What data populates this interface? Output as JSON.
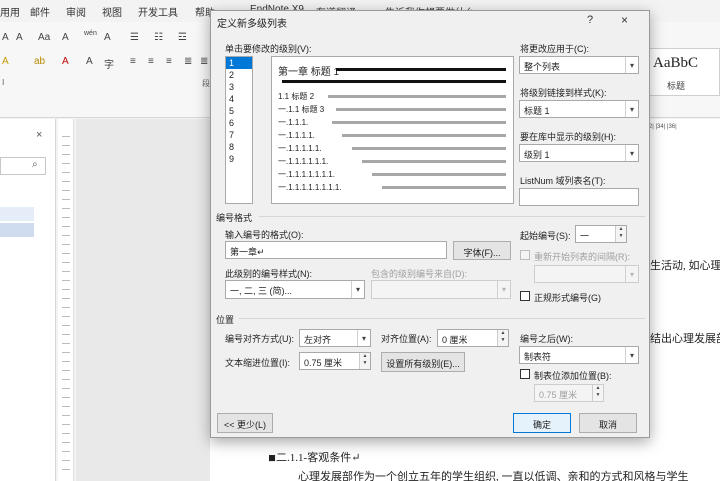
{
  "word": {
    "ribbon_tabs": [
      "用用",
      "邮件",
      "审阅",
      "视图",
      "开发工具",
      "帮助",
      "EndNote X9",
      "有道翻译",
      "告诉我你想要做什么"
    ],
    "ribbon_controls": {
      "font_size_up": "A",
      "font_size_down": "A",
      "change_case": "Aa",
      "clear_format": "A",
      "phonetic": "wén",
      "char_border": "A",
      "highlight": "ab",
      "font_color": "A",
      "char_shading": "A",
      "enclose_char": "字",
      "paragraph_label": "段",
      "style_preview": "AaBbC",
      "style_label": "标题"
    },
    "nav_pane": {
      "close": "×",
      "search_icon": "⌕"
    },
    "hruler_text": "|32| |34| |36|",
    "doc_lines": [
      "生活动, 如心理治",
      "结出心理发展部",
      "◾二.1.1-客观条件↵",
      "心理发展部作为一个创立五年的学生组织, 一直以低调、亲和的方式和风格与学生"
    ]
  },
  "dialog": {
    "title": "定义新多级列表",
    "help": "?",
    "close": "×",
    "levels_label": "单击要修改的级别(V):",
    "levels": [
      "1",
      "2",
      "3",
      "4",
      "5",
      "6",
      "7",
      "8",
      "9"
    ],
    "selected_level": "1",
    "preview_rows": [
      {
        "text": "第一章 标题 1"
      },
      {
        "text": ""
      },
      {
        "text": "1.1 标题 2"
      },
      {
        "text": "一.1.1 标题 3"
      },
      {
        "text": "一.1.1.1."
      },
      {
        "text": "一.1.1.1.1."
      },
      {
        "text": "一.1.1.1.1.1."
      },
      {
        "text": "一.1.1.1.1.1.1."
      },
      {
        "text": "一.1.1.1.1.1.1.1."
      },
      {
        "text": "一.1.1.1.1.1.1.1.1."
      }
    ],
    "apply_to_label": "将更改应用于(C):",
    "apply_to_value": "整个列表",
    "link_style_label": "将级别链接到样式(K):",
    "link_style_value": "标题 1",
    "gallery_level_label": "要在库中显示的级别(H):",
    "gallery_level_value": "级别 1",
    "listnum_label": "ListNum 域列表名(T):",
    "listnum_value": "",
    "number_format_section": "编号格式",
    "enter_format_label": "输入编号的格式(O):",
    "enter_format_value": "第一章↵",
    "font_button": "字体(F)...",
    "number_style_label": "此级别的编号样式(N):",
    "number_style_value": "一, 二, 三 (简)...",
    "include_level_label": "包含的级别编号来自(D):",
    "include_level_value": "",
    "start_at_label": "起始编号(S):",
    "start_at_value": "一",
    "restart_label": "重新开始列表的间隔(R):",
    "restart_value": "",
    "legal_label": "正规形式编号(G)",
    "position_section": "位置",
    "alignment_label": "编号对齐方式(U):",
    "alignment_value": "左对齐",
    "aligned_at_label": "对齐位置(A):",
    "aligned_at_value": "0 厘米",
    "follow_label": "编号之后(W):",
    "follow_value": "制表符",
    "indent_label": "文本缩进位置(I):",
    "indent_value": "0.75 厘米",
    "set_all_button": "设置所有级别(E)...",
    "tabstop_label": "制表位添加位置(B):",
    "tabstop_value": "0.75 厘米",
    "less_button": "<< 更少(L)",
    "ok_button": "确定",
    "cancel_button": "取消"
  }
}
